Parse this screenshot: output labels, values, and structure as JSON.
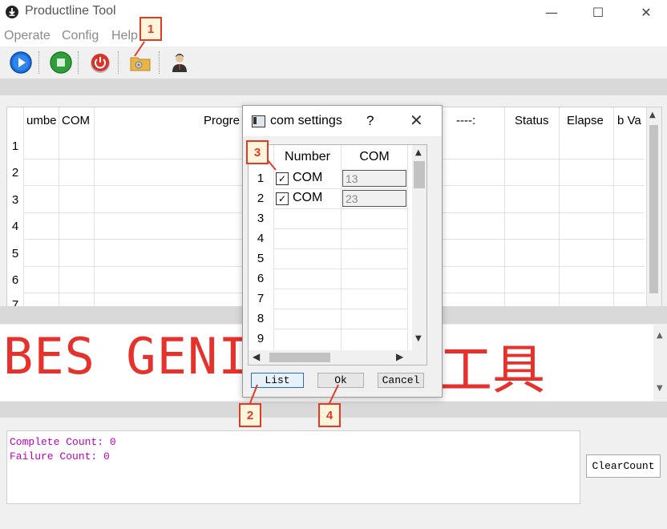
{
  "window": {
    "title": "Productline Tool",
    "controls": {
      "minimize": "—",
      "maximize": "☐",
      "close": "✕"
    }
  },
  "menu": {
    "items": [
      "Operate",
      "Config",
      "Help"
    ]
  },
  "toolbar": {
    "buttons": [
      {
        "icon": "play-icon",
        "color": "#1e6fd9"
      },
      {
        "icon": "stop-icon",
        "color": "#2e9d3a"
      },
      {
        "icon": "power-icon",
        "color": "#d8332b"
      },
      {
        "icon": "settings-folder-icon",
        "color": "#e8b547"
      },
      {
        "icon": "user-icon",
        "color": "#333333"
      }
    ]
  },
  "main_table": {
    "headers": [
      "umbe",
      "COM",
      "Progre",
      "----:",
      "Status",
      "Elapse",
      "b Va"
    ],
    "row_numbers": [
      "1",
      "2",
      "3",
      "4",
      "5",
      "6",
      "7"
    ]
  },
  "banner": {
    "text": "BES GENI",
    "suffix": "工具",
    "color": "#e6322c"
  },
  "log": {
    "lines": [
      "Complete Count: 0",
      "Failure Count: 0"
    ],
    "color": "#c000c0"
  },
  "clear_button": "ClearCount",
  "dialog": {
    "title": "com settings",
    "help": "?",
    "close": "✕",
    "headers": [
      "Number",
      "COM"
    ],
    "rows": [
      {
        "num": "1",
        "checked": true,
        "label": "COM",
        "value": "13"
      },
      {
        "num": "2",
        "checked": true,
        "label": "COM",
        "value": "23"
      },
      {
        "num": "3"
      },
      {
        "num": "4"
      },
      {
        "num": "5"
      },
      {
        "num": "6"
      },
      {
        "num": "7"
      },
      {
        "num": "8"
      },
      {
        "num": "9"
      }
    ],
    "buttons": {
      "list": "List",
      "ok": "Ok",
      "cancel": "Cancel"
    }
  },
  "annotations": [
    "1",
    "2",
    "3",
    "4"
  ],
  "accent_colors": {
    "annotation": "#e23a25"
  }
}
